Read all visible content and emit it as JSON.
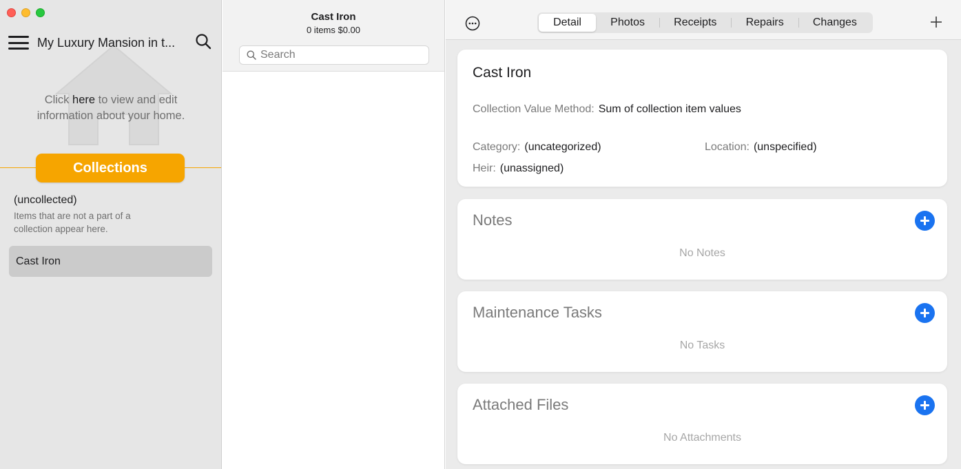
{
  "sidebar": {
    "home_title": "My Luxury Mansion in t...",
    "hint_prefix": "Click ",
    "hint_link": "here",
    "hint_line1_rest": " to view and edit",
    "hint_line2": "information about your home.",
    "collections_label": "Collections",
    "uncollected_title": "(uncollected)",
    "uncollected_desc_line1": "Items that are not a part of a",
    "uncollected_desc_line2": "collection appear here.",
    "selected_item": "Cast Iron"
  },
  "middle": {
    "title": "Cast Iron",
    "subtitle": "0 items $0.00",
    "search_placeholder": "Search"
  },
  "toolbar": {
    "tabs": [
      "Detail",
      "Photos",
      "Receipts",
      "Repairs",
      "Changes"
    ],
    "active_tab": "Detail"
  },
  "detail": {
    "title": "Cast Iron",
    "value_method_label": "Collection Value Method:",
    "value_method": "Sum of collection item values",
    "category_label": "Category:",
    "category": "(uncategorized)",
    "location_label": "Location:",
    "location": "(unspecified)",
    "heir_label": "Heir:",
    "heir": "(unassigned)"
  },
  "sections": {
    "notes_title": "Notes",
    "notes_empty": "No Notes",
    "tasks_title": "Maintenance Tasks",
    "tasks_empty": "No Tasks",
    "files_title": "Attached Files",
    "files_empty": "No Attachments"
  },
  "colors": {
    "accent_orange": "#f6a500",
    "accent_blue": "#1a73f0",
    "sidebar_bg": "#e6e6e6"
  },
  "icons": [
    "hamburger-icon",
    "search-icon",
    "house-icon",
    "more-icon",
    "plus-icon",
    "add-circle-icon"
  ]
}
